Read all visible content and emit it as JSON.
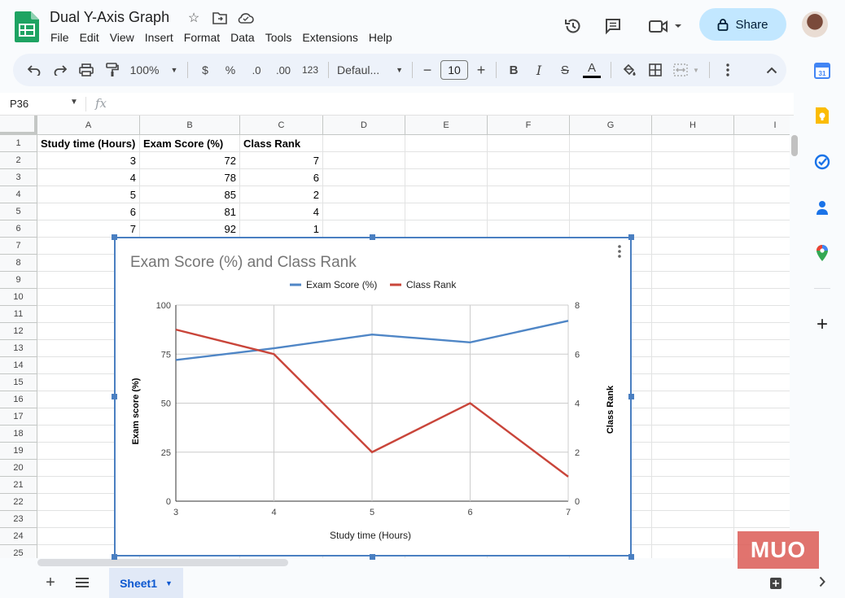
{
  "app": {
    "doc_title": "Dual Y-Axis Graph",
    "menu": [
      "File",
      "Edit",
      "View",
      "Insert",
      "Format",
      "Data",
      "Tools",
      "Extensions",
      "Help"
    ],
    "share_label": "Share"
  },
  "toolbar": {
    "zoom": "100%",
    "currency": "$",
    "percent": "%",
    "decrease_decimal": ".0",
    "increase_decimal": ".00",
    "number_format": "123",
    "font_name": "Defaul...",
    "font_size": "10",
    "bold": "B",
    "italic": "I",
    "strike": "S",
    "text_color": "A"
  },
  "formula_bar": {
    "name_box": "P36",
    "fx": "fx"
  },
  "columns": [
    "A",
    "B",
    "C",
    "D",
    "E",
    "F",
    "G",
    "H",
    "I"
  ],
  "rows": [
    "1",
    "2",
    "3",
    "4",
    "5",
    "6",
    "7",
    "8",
    "9",
    "10",
    "11",
    "12",
    "13",
    "14",
    "15",
    "16",
    "17",
    "18",
    "19",
    "20",
    "21",
    "22",
    "23",
    "24",
    "25"
  ],
  "table": {
    "headers": [
      "Study time (Hours)",
      "Exam Score (%)",
      "Class Rank"
    ],
    "rows": [
      [
        "3",
        "72",
        "7"
      ],
      [
        "4",
        "78",
        "6"
      ],
      [
        "5",
        "85",
        "2"
      ],
      [
        "6",
        "81",
        "4"
      ],
      [
        "7",
        "92",
        "1"
      ]
    ]
  },
  "sheet": {
    "tab_label": "Sheet1"
  },
  "watermark": "MUO",
  "colors": {
    "series1": "#4f86c6",
    "series2": "#c9453a",
    "selection": "#4a7fc1",
    "share_bg": "#c2e7ff"
  },
  "chart_data": {
    "type": "line",
    "title": "Exam Score (%) and Class Rank",
    "xlabel": "Study time (Hours)",
    "ylabel_left": "Exam score (%)",
    "ylabel_right": "Class Rank",
    "x": [
      3,
      4,
      5,
      6,
      7
    ],
    "x_ticks": [
      "3",
      "4",
      "5",
      "6",
      "7"
    ],
    "ylim_left": [
      0,
      100
    ],
    "yticks_left": [
      "0",
      "25",
      "50",
      "75",
      "100"
    ],
    "ylim_right": [
      0,
      8
    ],
    "yticks_right": [
      "0",
      "2",
      "4",
      "6",
      "8"
    ],
    "legend_position": "top",
    "grid": true,
    "series": [
      {
        "name": "Exam Score (%)",
        "axis": "left",
        "values": [
          72,
          78,
          85,
          81,
          92
        ]
      },
      {
        "name": "Class Rank",
        "axis": "right",
        "values": [
          7,
          6,
          2,
          4,
          1
        ]
      }
    ]
  }
}
